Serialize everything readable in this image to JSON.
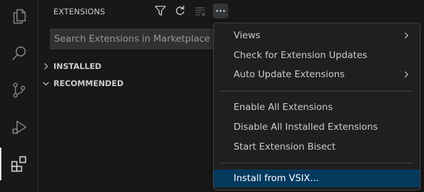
{
  "sidebar": {
    "title": "EXTENSIONS",
    "search": {
      "placeholder": "Search Extensions in Marketplace",
      "value": ""
    },
    "sections": [
      {
        "label": "INSTALLED",
        "expanded": false
      },
      {
        "label": "RECOMMENDED",
        "expanded": true
      }
    ],
    "toolbar_icons": [
      "filter-icon",
      "refresh-icon",
      "clear-icon",
      "more-actions-icon"
    ]
  },
  "activity_bar": {
    "items": [
      "explorer-icon",
      "search-icon",
      "source-control-icon",
      "run-debug-icon",
      "extensions-icon"
    ],
    "active": "extensions-icon"
  },
  "context_menu": {
    "groups": [
      [
        {
          "label": "Views",
          "submenu": true
        },
        {
          "label": "Check for Extension Updates",
          "submenu": false
        },
        {
          "label": "Auto Update Extensions",
          "submenu": true
        }
      ],
      [
        {
          "label": "Enable All Extensions",
          "submenu": false
        },
        {
          "label": "Disable All Installed Extensions",
          "submenu": false
        },
        {
          "label": "Start Extension Bisect",
          "submenu": false
        }
      ],
      [
        {
          "label": "Install from VSIX...",
          "submenu": false,
          "selected": true
        }
      ]
    ]
  },
  "colors": {
    "background": "#181818",
    "menu_background": "#1f1f1f",
    "selected_item": "#04395e",
    "text": "#cccccc",
    "icon": "#858585"
  }
}
